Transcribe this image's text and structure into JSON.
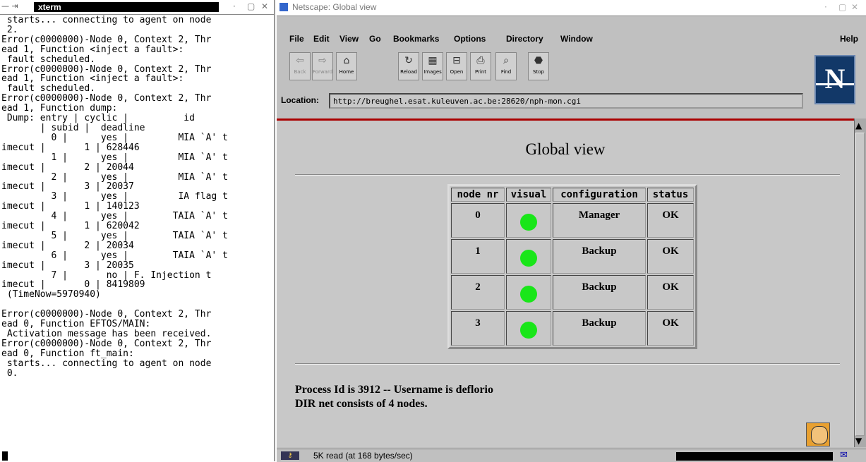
{
  "xterm": {
    "title": "xterm",
    "menu_glyph": "— ⇥",
    "controls": [
      "·",
      "▢",
      "✕"
    ],
    "lines": [
      " starts... connecting to agent on node",
      " 2.",
      "Error(c0000000)-Node 0, Context 2, Thr",
      "ead 1, Function <inject a fault>:",
      " fault scheduled.",
      "Error(c0000000)-Node 0, Context 2, Thr",
      "ead 1, Function <inject a fault>:",
      " fault scheduled.",
      "Error(c0000000)-Node 0, Context 2, Thr",
      "ead 1, Function dump:",
      " Dump: entry | cyclic |          id",
      "       | subid |  deadline",
      "         0 |      yes |         MIA `A' t",
      "imecut |       1 | 628446",
      "         1 |      yes |         MIA `A' t",
      "imecut |       2 | 20044",
      "         2 |      yes |         MIA `A' t",
      "imecut |       3 | 20037",
      "         3 |      yes |         IA flag t",
      "imecut |       1 | 140123",
      "         4 |      yes |        TAIA `A' t",
      "imecut |       1 | 620042",
      "         5 |      yes |        TAIA `A' t",
      "imecut |       2 | 20034",
      "         6 |      yes |        TAIA `A' t",
      "imecut |       3 | 20035",
      "         7 |       no | F. Injection t",
      "imecut |       0 | 8419809",
      " (TimeNow=5970940)",
      "",
      "Error(c0000000)-Node 0, Context 2, Thr",
      "ead 0, Function EFTOS/MAIN:",
      " Activation message has been received.",
      "Error(c0000000)-Node 0, Context 2, Thr",
      "ead 0, Function ft_main:",
      " starts... connecting to agent on node",
      " 0."
    ]
  },
  "netscape": {
    "window_title": "Netscape: Global view",
    "menus": [
      "File",
      "Edit",
      "View",
      "Go",
      "Bookmarks",
      "Options",
      "Directory",
      "Window"
    ],
    "help": "Help",
    "toolbar": [
      {
        "label": "Back",
        "glyph": "⇦",
        "icon": "back-icon",
        "enabled": false
      },
      {
        "label": "Forward",
        "glyph": "⇨",
        "icon": "forward-icon",
        "enabled": false
      },
      {
        "label": "Home",
        "glyph": "⌂",
        "icon": "home-icon",
        "enabled": true
      },
      {
        "label": "Reload",
        "glyph": "↻",
        "icon": "reload-icon",
        "enabled": true
      },
      {
        "label": "Images",
        "glyph": "▦",
        "icon": "images-icon",
        "enabled": true
      },
      {
        "label": "Open",
        "glyph": "⊟",
        "icon": "open-icon",
        "enabled": true
      },
      {
        "label": "Print",
        "glyph": "⎙",
        "icon": "print-icon",
        "enabled": true
      },
      {
        "label": "Find",
        "glyph": "⌕",
        "icon": "find-icon",
        "enabled": true
      },
      {
        "label": "Stop",
        "glyph": "⬣",
        "icon": "stop-icon",
        "enabled": true
      }
    ],
    "location_label": "Location:",
    "location_url": "http://breughel.esat.kuleuven.ac.be:28620/nph-mon.cgi",
    "logo_letter": "N",
    "page": {
      "title": "Global view",
      "table": {
        "headers": [
          "node nr",
          "visual",
          "configuration",
          "status"
        ],
        "rows": [
          {
            "node": "0",
            "configuration": "Manager",
            "status": "OK"
          },
          {
            "node": "1",
            "configuration": "Backup",
            "status": "OK"
          },
          {
            "node": "2",
            "configuration": "Backup",
            "status": "OK"
          },
          {
            "node": "3",
            "configuration": "Backup",
            "status": "OK"
          }
        ],
        "visual_color": "#19e619"
      },
      "info_lines": [
        "Process Id is 3912 -- Username is deflorio",
        "DIR net consists of 4 nodes."
      ]
    },
    "status_text": "5K read (at 168 bytes/sec)",
    "accent_red": "#aa0000"
  }
}
